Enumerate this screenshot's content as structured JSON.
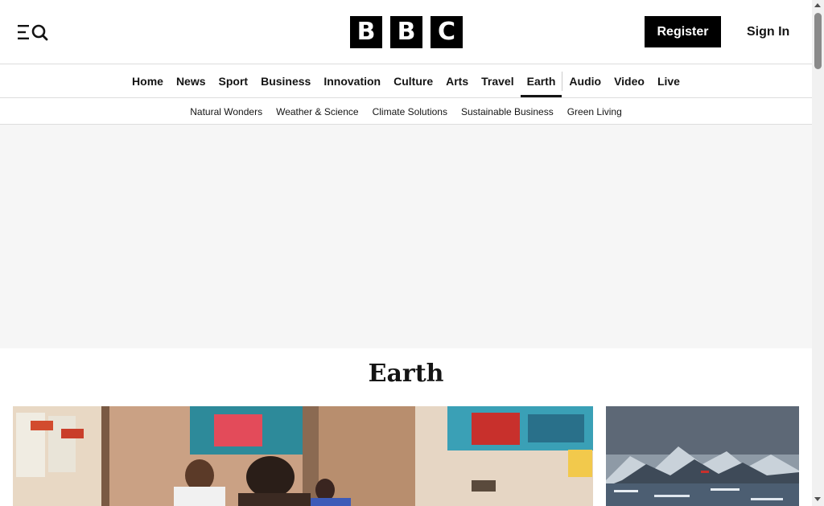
{
  "header": {
    "menu_icon": "menu-search-icon",
    "logo_letters": [
      "B",
      "B",
      "C"
    ],
    "register_label": "Register",
    "signin_label": "Sign In"
  },
  "main_nav": {
    "items": [
      "Home",
      "News",
      "Sport",
      "Business",
      "Innovation",
      "Culture",
      "Arts",
      "Travel",
      "Earth",
      "Audio",
      "Video",
      "Live"
    ],
    "active": "Earth"
  },
  "sub_nav": {
    "items": [
      "Natural Wonders",
      "Weather & Science",
      "Climate Solutions",
      "Sustainable Business",
      "Green Living"
    ]
  },
  "section": {
    "title": "Earth"
  },
  "colors": {
    "brand": "#000000",
    "text": "#141414",
    "ad_background": "#f6f6f6"
  }
}
